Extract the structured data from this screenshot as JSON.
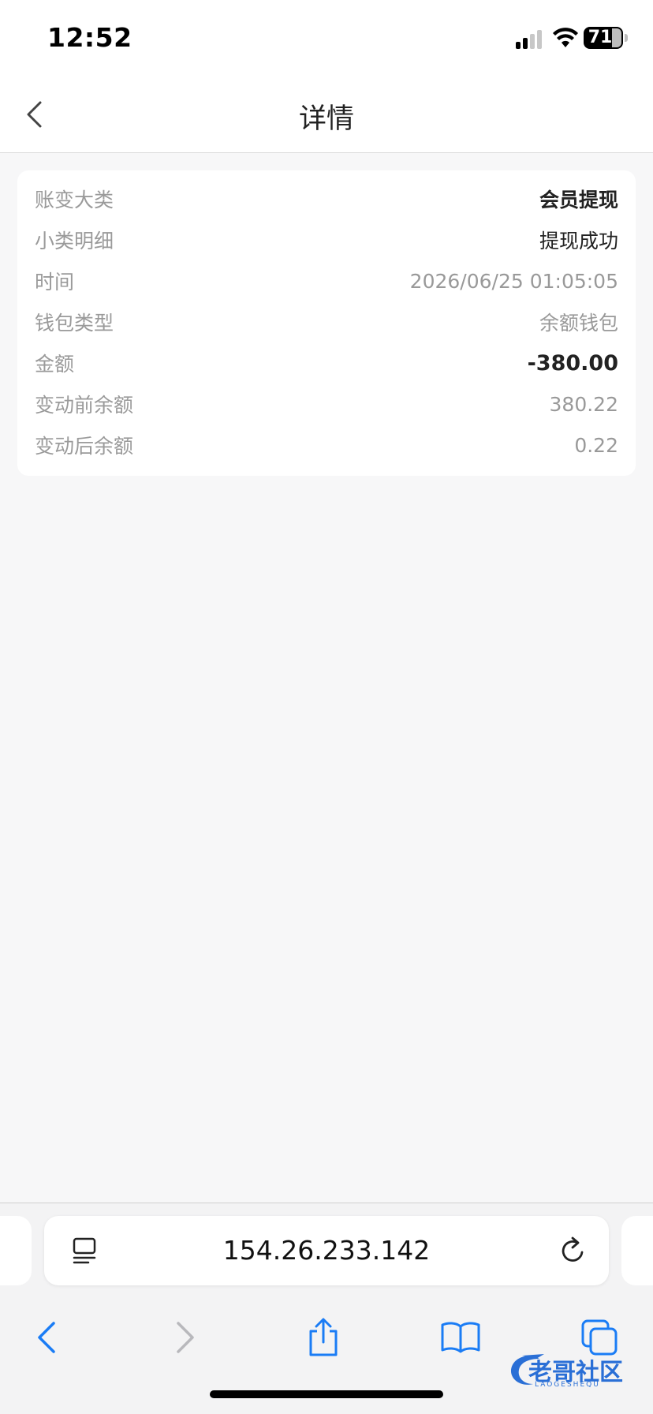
{
  "status_bar": {
    "time": "12:52",
    "battery": "71",
    "icons": [
      "signal-icon",
      "wifi-icon",
      "battery-icon"
    ]
  },
  "nav": {
    "title": "详情",
    "back_icon": "chevron-left-icon"
  },
  "details": [
    {
      "label": "账变大类",
      "value": "会员提现"
    },
    {
      "label": "小类明细",
      "value": "提现成功"
    },
    {
      "label": "时间",
      "value": "2026/06/25 01:05:05"
    },
    {
      "label": "钱包类型",
      "value": "余额钱包"
    },
    {
      "label": "金额",
      "value": "-380.00"
    },
    {
      "label": "变动前余额",
      "value": "380.22"
    },
    {
      "label": "变动后余额",
      "value": "0.22"
    }
  ],
  "browser": {
    "address": "154.26.233.142",
    "accent_color": "#1a7cf5"
  },
  "watermark": {
    "text": "老哥社区",
    "sub": "LAOGESHEQU"
  }
}
